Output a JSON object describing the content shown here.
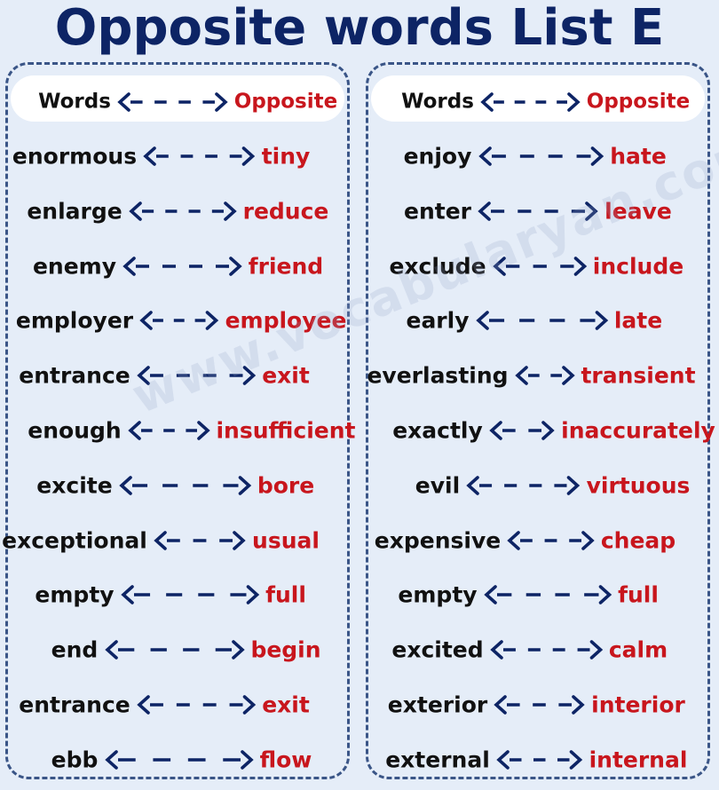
{
  "title": "Opposite words List E",
  "watermark": "www.vocabularyan.com",
  "colors": {
    "title": "#0d2465",
    "word": "#111111",
    "opposite": "#c8161d",
    "arrow": "#0d2465",
    "background": "#e5edf8"
  },
  "columns": [
    {
      "header": {
        "word": "Words",
        "opposite": "Opposite"
      },
      "pairs": [
        {
          "word": "enormous",
          "opposite": "tiny"
        },
        {
          "word": "enlarge",
          "opposite": "reduce"
        },
        {
          "word": "enemy",
          "opposite": "friend"
        },
        {
          "word": "employer",
          "opposite": "employee"
        },
        {
          "word": "entrance",
          "opposite": "exit"
        },
        {
          "word": "enough",
          "opposite": "insufficient"
        },
        {
          "word": "excite",
          "opposite": "bore"
        },
        {
          "word": "exceptional",
          "opposite": "usual"
        },
        {
          "word": "empty",
          "opposite": "full"
        },
        {
          "word": "end",
          "opposite": "begin"
        },
        {
          "word": "entrance",
          "opposite": "exit"
        },
        {
          "word": "ebb",
          "opposite": "flow"
        }
      ]
    },
    {
      "header": {
        "word": "Words",
        "opposite": "Opposite"
      },
      "pairs": [
        {
          "word": "enjoy",
          "opposite": "hate"
        },
        {
          "word": "enter",
          "opposite": "leave"
        },
        {
          "word": "exclude",
          "opposite": "include"
        },
        {
          "word": "early",
          "opposite": "late"
        },
        {
          "word": "everlasting",
          "opposite": "transient"
        },
        {
          "word": "exactly",
          "opposite": "inaccurately"
        },
        {
          "word": "evil",
          "opposite": "virtuous"
        },
        {
          "word": "expensive",
          "opposite": "cheap"
        },
        {
          "word": "empty",
          "opposite": "full"
        },
        {
          "word": "excited",
          "opposite": "calm"
        },
        {
          "word": "exterior",
          "opposite": "interior"
        },
        {
          "word": "external",
          "opposite": "internal"
        }
      ]
    }
  ]
}
